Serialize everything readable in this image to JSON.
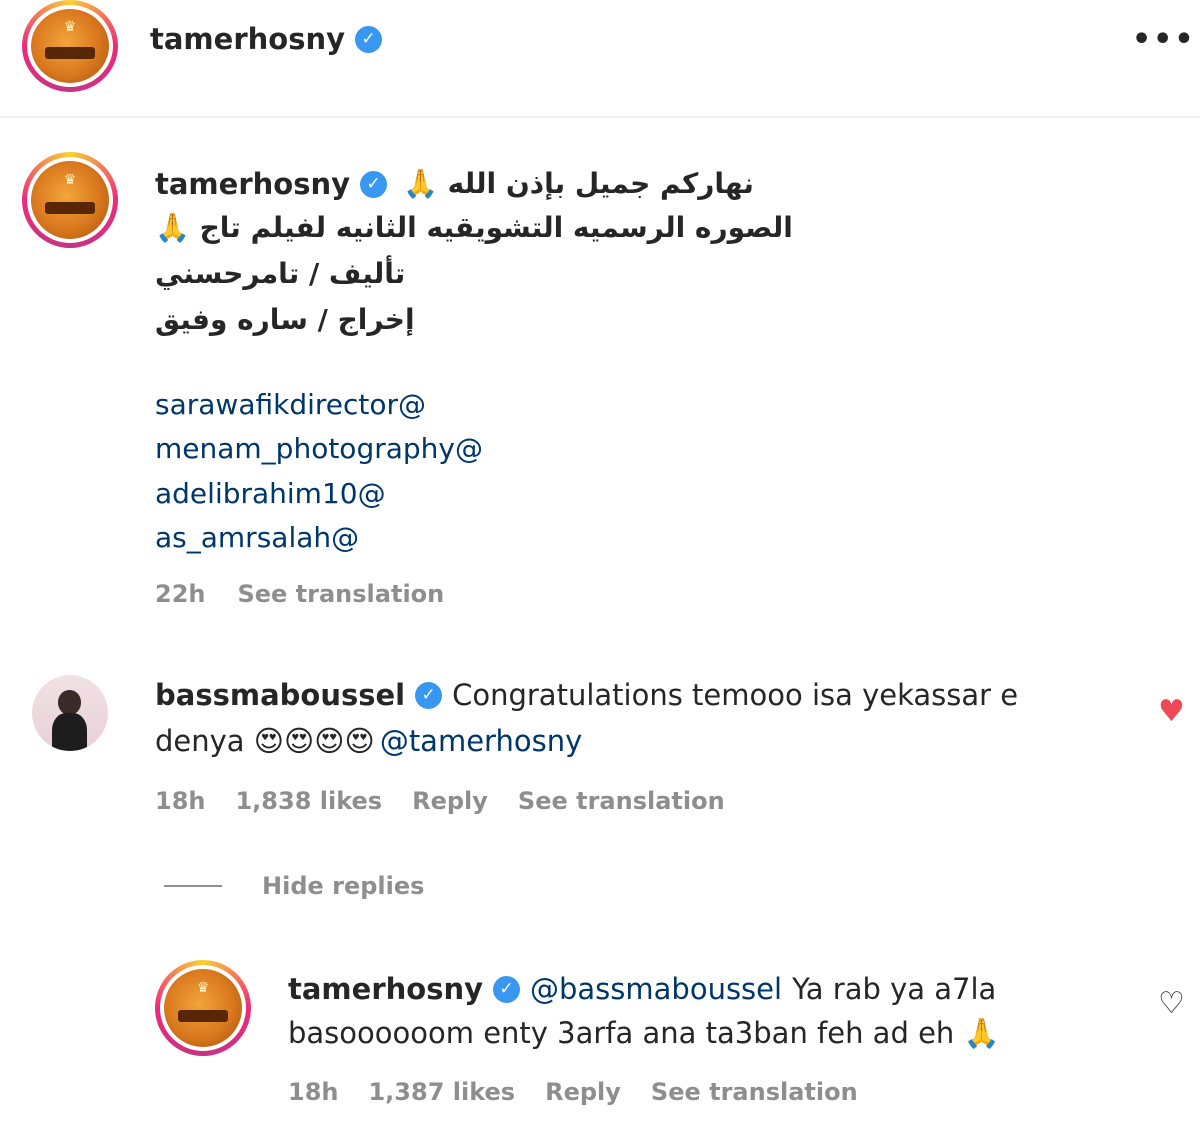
{
  "header": {
    "username": "tamerhosny",
    "more_icon": "more-horizontal-icon"
  },
  "post": {
    "username": "tamerhosny",
    "caption_lines": [
      "نهاركم جميل بإذن الله 🙏",
      "الصوره الرسميه التشويقيه الثانيه لفيلم تاج 🙏",
      "تأليف / تامرحسني",
      "إخراج / ساره وفيق"
    ],
    "mentions": [
      "sarawafikdirector@",
      "menam_photography@",
      "adelibrahim10@",
      "as_amrsalah@"
    ],
    "time": "22h",
    "see_translation": "See translation"
  },
  "comment": {
    "username": "bassmaboussel",
    "text_line1": "Congratulations temooo isa yekassar e",
    "text_line2_prefix": "denya 😍😍😍😍",
    "mention": "@tamerhosny",
    "time": "18h",
    "likes": "1,838 likes",
    "reply": "Reply",
    "see_translation": "See translation",
    "liked": true,
    "hide_replies": "Hide replies"
  },
  "reply": {
    "username": "tamerhosny",
    "mention": "@bassmaboussel",
    "text_line1": "Ya rab ya a7la",
    "text_line2": "basoooooom enty 3arfa ana ta3ban feh ad eh 🙏",
    "time": "18h",
    "likes": "1,387 likes",
    "reply": "Reply",
    "see_translation": "See translation",
    "liked": false
  },
  "colors": {
    "verified": "#3897f0",
    "link": "#00376b",
    "meta": "#8e8e8e",
    "heart_liked": "#ed4956"
  }
}
